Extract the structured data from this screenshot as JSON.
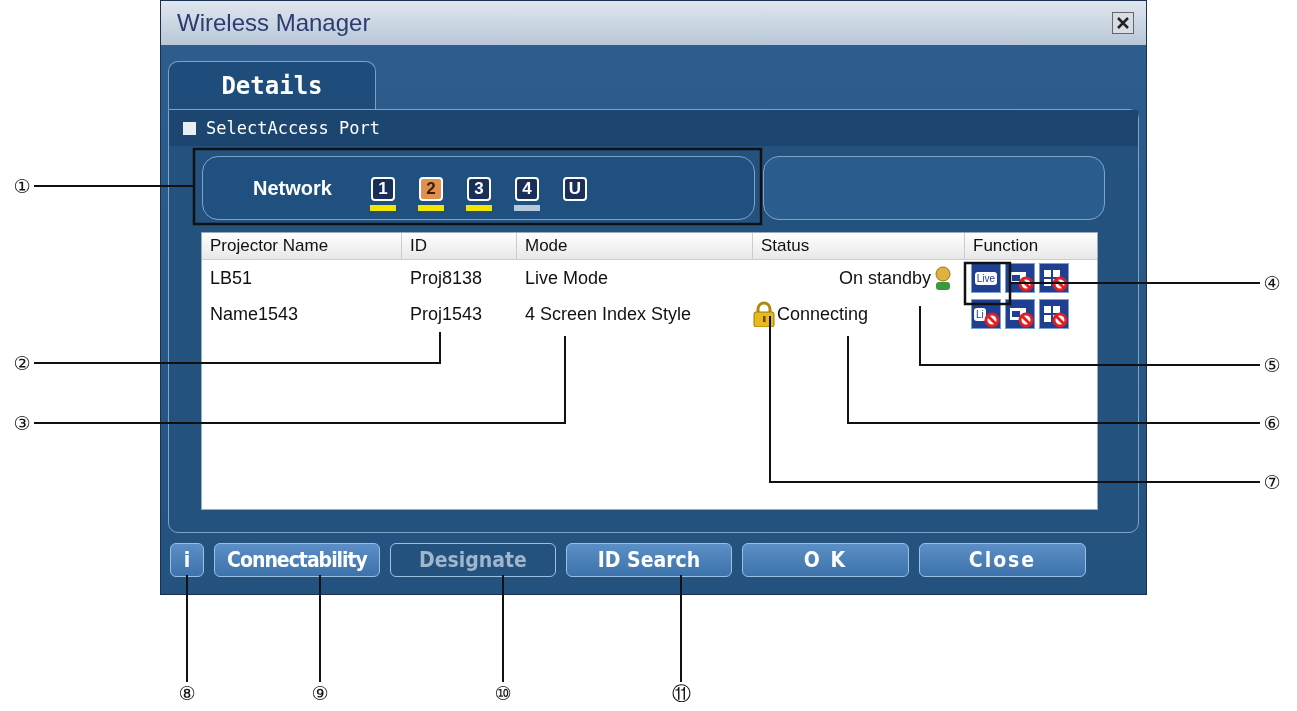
{
  "window": {
    "title": "Wireless Manager"
  },
  "tabs": [
    {
      "label": "Details",
      "selected": true
    }
  ],
  "select_access_port": {
    "label": "SelectAccess Port",
    "checked": false
  },
  "network": {
    "label": "Network",
    "ports": [
      {
        "label": "1",
        "selected": false,
        "color": "#f2e600"
      },
      {
        "label": "2",
        "selected": true,
        "color": "#f2e600"
      },
      {
        "label": "3",
        "selected": false,
        "color": "#f2e600"
      },
      {
        "label": "4",
        "selected": false,
        "color": "#b8c8dc"
      },
      {
        "label": "U",
        "selected": false
      }
    ]
  },
  "table": {
    "columns": [
      "Projector Name",
      "ID",
      "Mode",
      "Status",
      "Function"
    ],
    "rows": [
      {
        "name": "LB51",
        "id": "Proj8138",
        "mode": "Live Mode",
        "status": "On standby",
        "kind": "person",
        "functions": [
          {
            "kind": "live",
            "label": "Live",
            "blocked": false
          },
          {
            "kind": "screen",
            "blocked": true
          },
          {
            "kind": "index",
            "blocked": true
          }
        ]
      },
      {
        "name": "Name1543",
        "id": "Proj1543",
        "mode": "4 Screen Index Style",
        "status": "Connecting",
        "kind": "lock",
        "functions": [
          {
            "kind": "live",
            "label": "Li",
            "blocked": true
          },
          {
            "kind": "screen",
            "blocked": true
          },
          {
            "kind": "index",
            "blocked": true
          }
        ]
      }
    ]
  },
  "buttons": [
    {
      "kind": "info",
      "label": "i",
      "disabled": false
    },
    {
      "kind": "normal",
      "label": "Connectability",
      "disabled": false
    },
    {
      "kind": "normal",
      "label": "Designate",
      "disabled": true
    },
    {
      "kind": "normal",
      "label": "ID Search",
      "disabled": false
    },
    {
      "kind": "wide",
      "label": "O K",
      "disabled": false
    },
    {
      "kind": "wide",
      "label": "Close",
      "disabled": false
    }
  ],
  "callouts": [
    {
      "label": "①"
    },
    {
      "label": "②"
    },
    {
      "label": "③"
    },
    {
      "label": "④"
    },
    {
      "label": "⑤"
    },
    {
      "label": "⑥"
    },
    {
      "label": "⑦"
    },
    {
      "label": "⑧"
    },
    {
      "label": "⑨"
    },
    {
      "label": "⑩"
    },
    {
      "label": "⑪"
    }
  ]
}
